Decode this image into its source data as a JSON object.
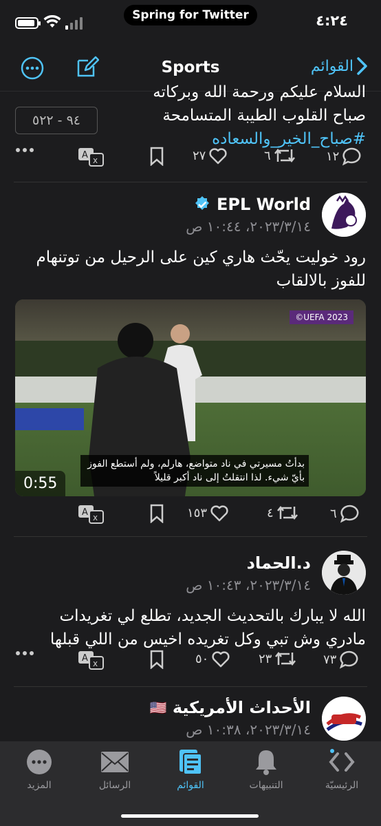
{
  "status_bar": {
    "app_name": "Spring for Twitter",
    "time": "٤:٢٤"
  },
  "nav": {
    "title": "Sports",
    "back_label": "القوائم"
  },
  "colors": {
    "accent": "#4fc3f7",
    "background": "#1c1c1e",
    "verified": "#4fc3f7"
  },
  "tweets": [
    {
      "text_line1": "السلام عليكم ورحمة الله وبركاته",
      "text_line2": "صباح القلوب الطيبة المتسامحة",
      "hashtag": "#صباح_الخير_والسعاده",
      "ratio": "٩٤ - ٥٢٢",
      "replies": "١٢",
      "retweets": "٦",
      "likes": "٢٧"
    },
    {
      "name": "EPL World",
      "verified": true,
      "time": "٢٠٢٣/٣/١٤، ١٠:٤٤ ص",
      "text": "رود خوليت يحّث هاري كين على الرحيل من توتنهام للفوز بالالقاب",
      "video": {
        "badge": "©UEFA 2023",
        "subtitle": "بدأتُ مسيرتي في ناد متواضع، هارلم، ولم أستطع الفوز بأيّ شيء. لذا انتقلتُ إلى ناد أكبر قليلاً",
        "duration": "0:55"
      },
      "replies": "٦",
      "retweets": "٤",
      "likes": "١٥٣"
    },
    {
      "name": "د.الحماد",
      "time": "٢٠٢٣/٣/١٤، ١٠:٤٣ ص",
      "text": "الله لا يبارك بالتحديث الجديد، تطلع لي تغريدات مادري وش تبي وكل تغريده اخيس من اللي قبلها",
      "replies": "٧٣",
      "retweets": "٢٣",
      "likes": "٥٠"
    },
    {
      "name": "الأحداث الأمريكية",
      "flag": "🇺🇸",
      "time": "٢٠٢٣/٣/١٤، ١٠:٣٨ ص"
    }
  ],
  "tabs": [
    {
      "label": "المزيد",
      "icon": "more-icon"
    },
    {
      "label": "الرسائل",
      "icon": "mail-icon"
    },
    {
      "label": "القوائم",
      "icon": "lists-icon",
      "active": true
    },
    {
      "label": "التنبيهات",
      "icon": "bell-icon"
    },
    {
      "label": "الرئيسيّة",
      "icon": "home-icon"
    }
  ]
}
